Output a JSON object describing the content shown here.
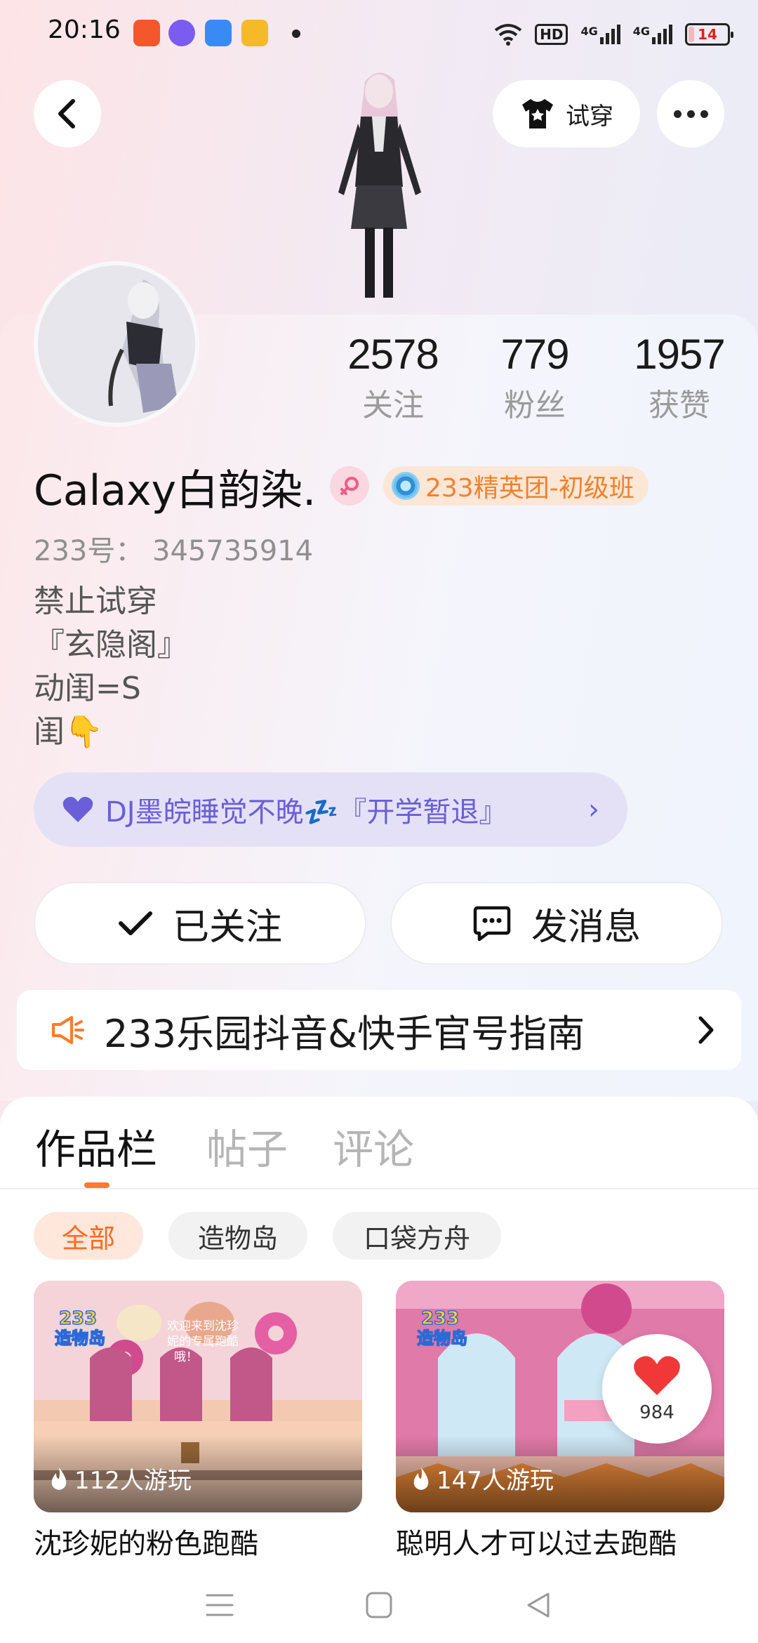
{
  "status_bar": {
    "time": "20:16",
    "battery": "14",
    "network": "4G",
    "hd_label": "HD"
  },
  "header": {
    "try_label": "试穿"
  },
  "stats": [
    {
      "value": "2578",
      "label": "关注"
    },
    {
      "value": "779",
      "label": "粉丝"
    },
    {
      "value": "1957",
      "label": "获赞"
    }
  ],
  "profile": {
    "nickname": "Calaxy白韵染.",
    "team_badge": "233精英团-初级班",
    "uid": "233号：  345735914",
    "bio": [
      "禁止试穿",
      "『玄隐阁』",
      "动闺=S",
      "闺👇"
    ]
  },
  "music": {
    "text": "DJ墨皖睡觉不晚💤『开学暂退』",
    "arrow": "›"
  },
  "actions": {
    "follow_label": "已关注",
    "message_label": "发消息"
  },
  "notice": {
    "text": "233乐园抖音&快手官号指南"
  },
  "tabs": [
    {
      "label": "作品栏",
      "active": true
    },
    {
      "label": "帖子",
      "active": false
    },
    {
      "label": "评论",
      "active": false
    }
  ],
  "filters": [
    {
      "label": "全部",
      "active": true
    },
    {
      "label": "造物岛",
      "active": false
    },
    {
      "label": "口袋方舟",
      "active": false
    }
  ],
  "works": [
    {
      "plays": "112人游玩",
      "title": "沈珍妮的粉色跑酷",
      "banner": "欢迎来到沈珍妮的专属跑酷哦！",
      "logo": "233造物岛"
    },
    {
      "plays": "147人游玩",
      "title": "聪明人才可以过去跑酷",
      "logo": "233造物岛"
    }
  ],
  "like": {
    "count": "984"
  },
  "colors": {
    "accent": "#ff7a2d",
    "music_text": "#6a5fd6",
    "team_text": "#f0822c"
  }
}
